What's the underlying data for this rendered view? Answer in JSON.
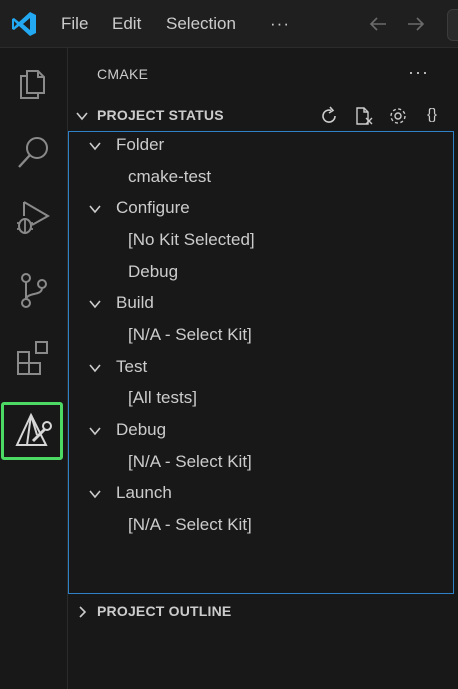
{
  "menu": {
    "file": "File",
    "edit": "Edit",
    "selection": "Selection",
    "more": "···"
  },
  "activity_bar": {
    "items": [
      {
        "name": "explorer",
        "icon": "files-icon"
      },
      {
        "name": "search",
        "icon": "search-icon"
      },
      {
        "name": "run-and-debug",
        "icon": "debug-icon"
      },
      {
        "name": "source-control",
        "icon": "source-control-icon"
      },
      {
        "name": "extensions",
        "icon": "extensions-icon"
      },
      {
        "name": "cmake",
        "icon": "cmake-icon",
        "active": true
      }
    ],
    "active_highlight_color": "#4cd964"
  },
  "sidebar": {
    "title": "CMAKE",
    "more": "···",
    "project_status": {
      "label": "PROJECT STATUS",
      "actions": [
        "refresh-icon",
        "new-file-icon",
        "gear-icon",
        "{}"
      ]
    },
    "tree": [
      {
        "label": "Folder",
        "child": "cmake-test"
      },
      {
        "label": "Configure",
        "children": [
          "[No Kit Selected]",
          "Debug"
        ]
      },
      {
        "label": "Build",
        "child": "[N/A - Select Kit]"
      },
      {
        "label": "Test",
        "child": "[All tests]"
      },
      {
        "label": "Debug",
        "child": "[N/A - Select Kit]"
      },
      {
        "label": "Launch",
        "child": "[N/A - Select Kit]"
      }
    ],
    "project_outline": {
      "label": "PROJECT OUTLINE"
    }
  },
  "colors": {
    "background": "#181818",
    "focus_border": "#2f81c7",
    "text": "#cccccc",
    "vscode_blue": "#23a9f2"
  }
}
